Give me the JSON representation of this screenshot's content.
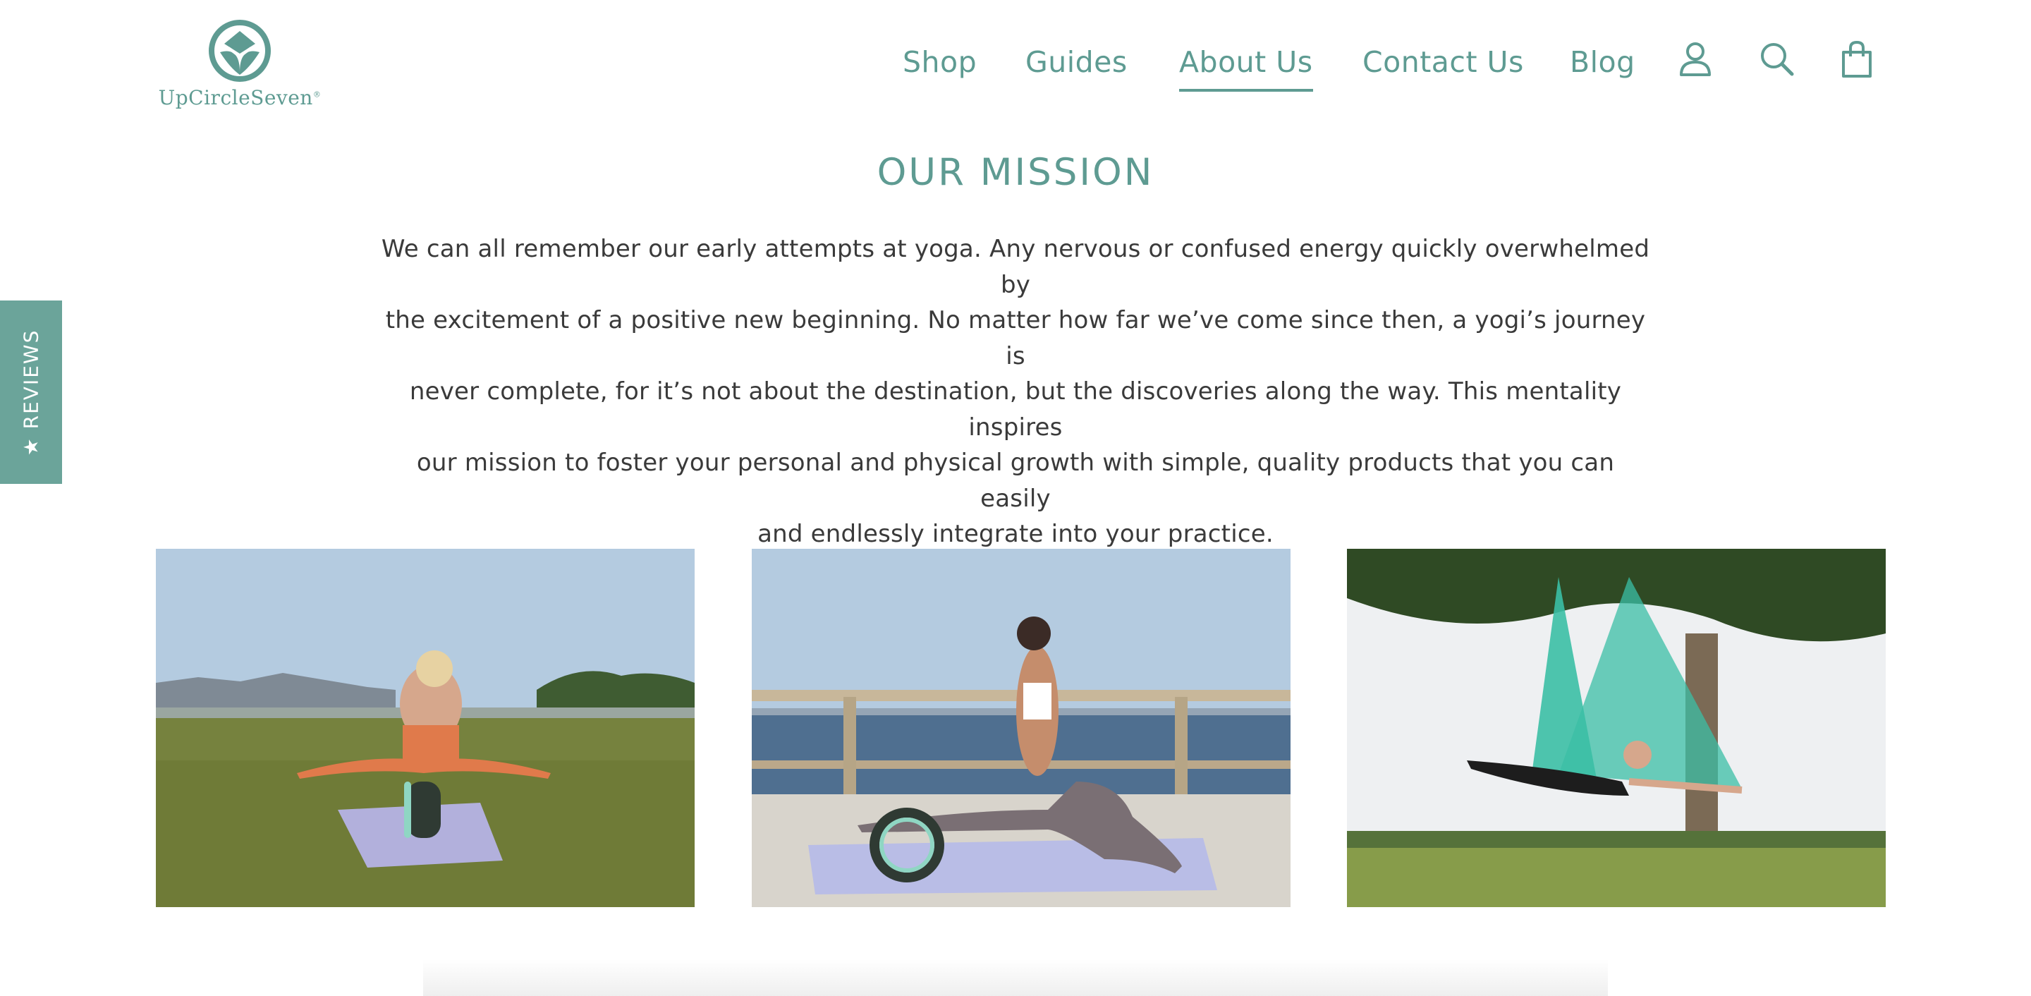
{
  "brand": {
    "name": "UpCircleSeven",
    "logo_text": "UpCircleSeven",
    "color": "#5e9b92"
  },
  "nav": {
    "items": [
      {
        "label": "Shop",
        "active": false
      },
      {
        "label": "Guides",
        "active": false
      },
      {
        "label": "About Us",
        "active": true
      },
      {
        "label": "Contact Us",
        "active": false
      },
      {
        "label": "Blog",
        "active": false
      }
    ],
    "icons": [
      "account-icon",
      "search-icon",
      "cart-icon"
    ]
  },
  "mission": {
    "title": "OUR MISSION",
    "lines": [
      "We can all remember our early attempts at yoga. Any nervous or confused energy quickly overwhelmed by",
      "the excitement of a positive new beginning. No matter how far we’ve come since then, a yogi’s journey is",
      "never complete, for it’s not about the destination, but the discoveries along the way. This mentality inspires",
      "our mission to foster your personal and physical growth with simple, quality products that you can easily",
      "and endlessly integrate into your practice."
    ]
  },
  "reviews_tab": {
    "star": "★",
    "label": "REVIEWS",
    "color": "#6ba49a"
  },
  "gallery": {
    "photos": [
      {
        "subject": "yoga-wheel-grass"
      },
      {
        "subject": "yoga-wheel-beach"
      },
      {
        "subject": "aerial-yoga-hammock"
      }
    ]
  }
}
